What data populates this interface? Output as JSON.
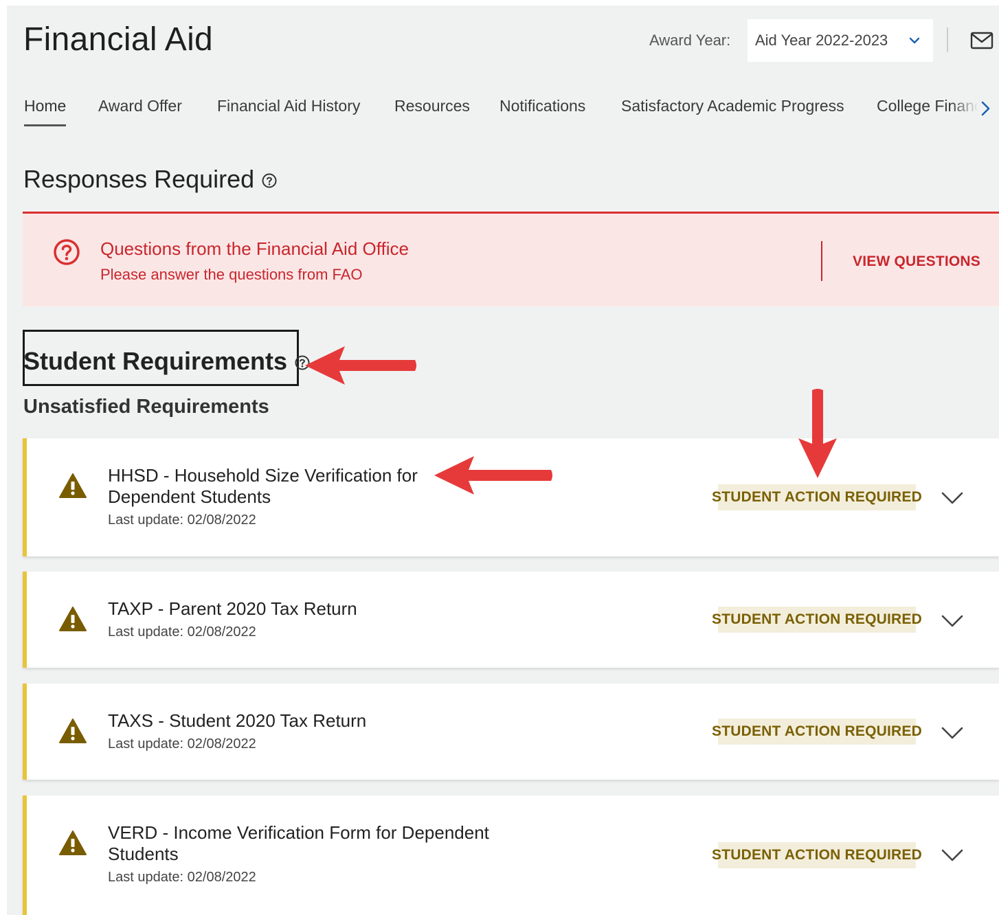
{
  "header": {
    "title": "Financial Aid",
    "award_year_label": "Award Year:",
    "award_year_value": "Aid Year 2022-2023"
  },
  "tabs": [
    {
      "label": "Home",
      "active": true
    },
    {
      "label": "Award Offer"
    },
    {
      "label": "Financial Aid History"
    },
    {
      "label": "Resources"
    },
    {
      "label": "Notifications"
    },
    {
      "label": "Satisfactory Academic Progress"
    },
    {
      "label": "College Financ"
    }
  ],
  "responses": {
    "heading": "Responses Required",
    "alert_title": "Questions from the Financial Aid Office",
    "alert_subtitle": "Please answer the questions from FAO",
    "alert_action": "VIEW QUESTIONS"
  },
  "student": {
    "heading": "Student Requirements",
    "subheading": "Unsatisfied Requirements",
    "requirements": [
      {
        "title": "HHSD - Household Size Verification for Dependent Students",
        "date": "Last update: 02/08/2022",
        "status": "STUDENT ACTION REQUIRED"
      },
      {
        "title": "TAXP - Parent 2020 Tax Return",
        "date": "Last update: 02/08/2022",
        "status": "STUDENT ACTION REQUIRED"
      },
      {
        "title": "TAXS - Student 2020 Tax Return",
        "date": "Last update: 02/08/2022",
        "status": "STUDENT ACTION REQUIRED"
      },
      {
        "title": "VERD - Income Verification Form for Dependent Students",
        "date": "Last update: 02/08/2022",
        "status": "STUDENT ACTION REQUIRED"
      }
    ]
  },
  "colors": {
    "alert_red": "#c8262c",
    "warning_gold": "#e9c43a",
    "badge_text": "#7a6005",
    "annotation_arrow": "#e63a3a"
  }
}
